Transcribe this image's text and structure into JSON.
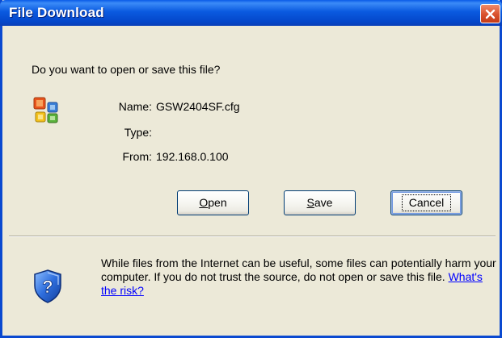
{
  "window": {
    "title": "File Download",
    "close_icon": "close-icon"
  },
  "prompt": {
    "question": "Do you want to open or save this file?"
  },
  "file": {
    "icon": "office-document-icon",
    "name_label": "Name:",
    "name_value": "GSW2404SF.cfg",
    "type_label": "Type:",
    "type_value": "",
    "from_label": "From:",
    "from_value": "192.168.0.100"
  },
  "buttons": {
    "open": {
      "accel": "O",
      "rest": "pen"
    },
    "save": {
      "accel": "S",
      "rest": "ave"
    },
    "cancel": {
      "label": "Cancel"
    }
  },
  "warning": {
    "icon": "security-shield-question-icon",
    "text": "While files from the Internet can be useful, some files can potentially harm your computer. If you do not trust the source, do not open or save this file.",
    "link": "What's the risk?"
  },
  "colors": {
    "titlebar": "#0a5ae0",
    "dialog_bg": "#ece9d8",
    "close_button": "#d9512c",
    "link": "#0000ff"
  }
}
